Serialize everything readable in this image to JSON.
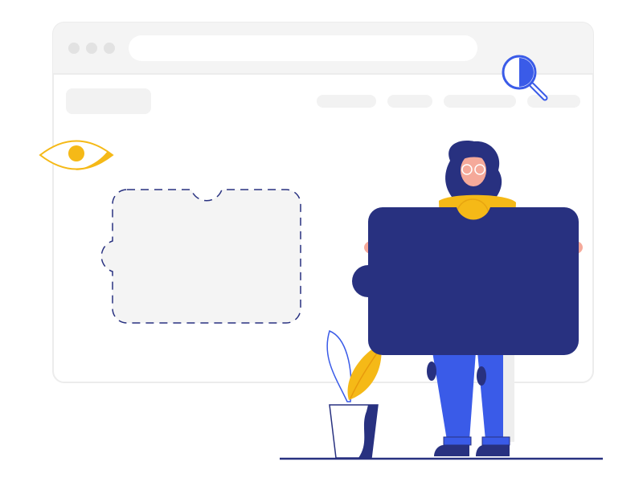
{
  "browser": {
    "window_dots": 3,
    "nav_items": 4
  },
  "icons": {
    "search": "magnifier-icon",
    "eye": "eye-icon",
    "puzzle_slot": "puzzle-slot-icon",
    "puzzle_piece": "puzzle-piece-icon",
    "plant": "potted-plant-icon"
  },
  "colors": {
    "navy": "#283180",
    "blue": "#3a5be8",
    "yellow": "#f5b917",
    "skin": "#f5a99a",
    "frame": "#f5f5f5",
    "frame_border": "#e6e6e6",
    "dash": "#283180"
  }
}
